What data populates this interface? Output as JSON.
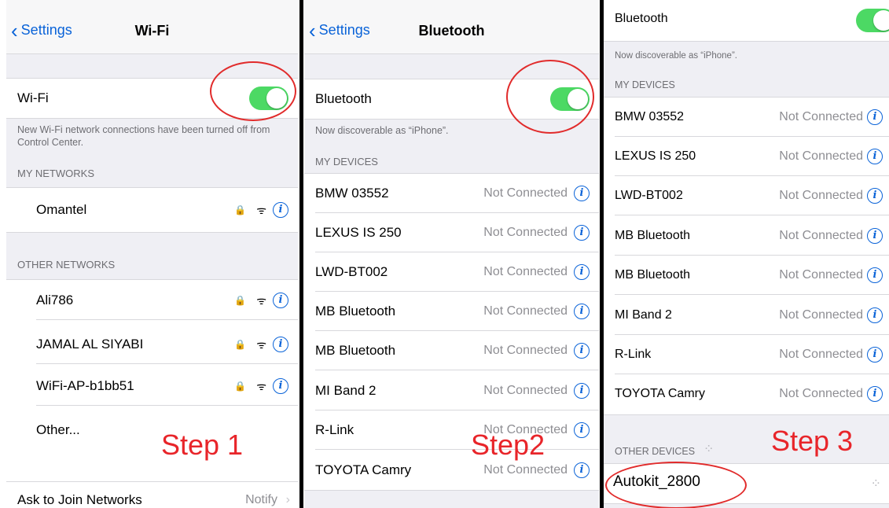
{
  "panel1": {
    "back_label": "Settings",
    "title": "Wi-Fi",
    "wifi_label": "Wi-Fi",
    "note": "New Wi-Fi network connections have been turned off from Control Center.",
    "my_networks_header": "MY NETWORKS",
    "my_networks": [
      {
        "name": "Omantel"
      }
    ],
    "other_networks_header": "OTHER NETWORKS",
    "other_networks": [
      {
        "name": "Ali786"
      },
      {
        "name": "JAMAL AL SIYABI"
      },
      {
        "name": "WiFi-AP-b1bb51"
      }
    ],
    "other_label": "Other...",
    "ask_label": "Ask to Join Networks",
    "ask_value": "Notify",
    "step_label": "Step 1"
  },
  "panel2": {
    "back_label": "Settings",
    "title": "Bluetooth",
    "bt_label": "Bluetooth",
    "discoverable": "Now discoverable as “iPhone”.",
    "my_devices_header": "MY DEVICES",
    "devices": [
      {
        "name": "BMW 03552",
        "status": "Not Connected"
      },
      {
        "name": "LEXUS IS 250",
        "status": "Not Connected"
      },
      {
        "name": "LWD-BT002",
        "status": "Not Connected"
      },
      {
        "name": "MB Bluetooth",
        "status": "Not Connected"
      },
      {
        "name": "MB Bluetooth",
        "status": "Not Connected"
      },
      {
        "name": "MI Band 2",
        "status": "Not Connected"
      },
      {
        "name": "R-Link",
        "status": "Not Connected"
      },
      {
        "name": "TOYOTA Camry",
        "status": "Not Connected"
      }
    ],
    "step_label": "Step2"
  },
  "panel3": {
    "bt_label": "Bluetooth",
    "discoverable": "Now discoverable as “iPhone”.",
    "my_devices_header": "MY DEVICES",
    "devices": [
      {
        "name": "BMW 03552",
        "status": "Not Connected"
      },
      {
        "name": "LEXUS IS 250",
        "status": "Not Connected"
      },
      {
        "name": "LWD-BT002",
        "status": "Not Connected"
      },
      {
        "name": "MB Bluetooth",
        "status": "Not Connected"
      },
      {
        "name": "MB Bluetooth",
        "status": "Not Connected"
      },
      {
        "name": "MI Band 2",
        "status": "Not Connected"
      },
      {
        "name": "R-Link",
        "status": "Not Connected"
      },
      {
        "name": "TOYOTA Camry",
        "status": "Not Connected"
      }
    ],
    "other_devices_header": "OTHER DEVICES",
    "other_devices": [
      {
        "name": "Autokit_2800"
      }
    ],
    "step_label": "Step 3"
  },
  "colors": {
    "accent": "#0a63d8",
    "toggle_on": "#4cd964",
    "annotation": "#e12b2b"
  },
  "icons": {
    "back": "chevron-left-icon",
    "info": "info-icon",
    "lock": "lock-icon",
    "wifi": "wifi-icon",
    "spinner": "spinner-icon"
  }
}
